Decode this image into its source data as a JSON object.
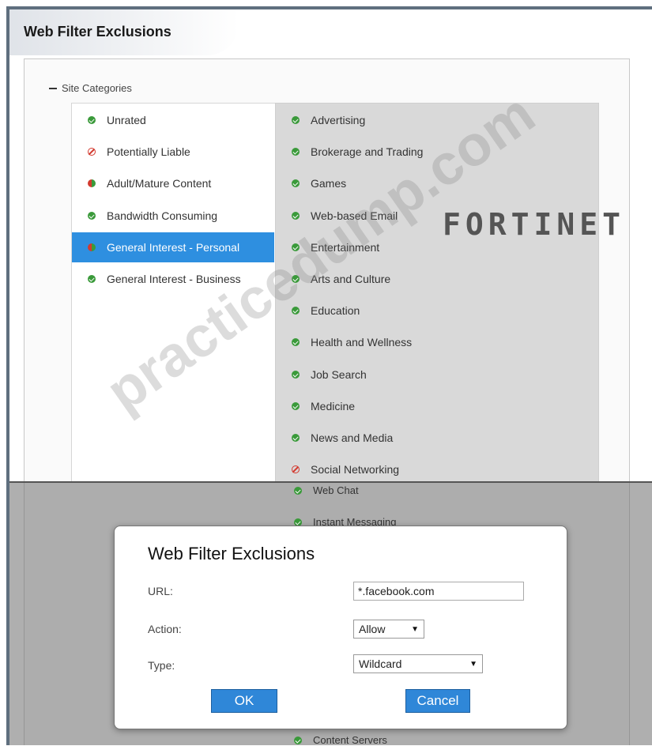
{
  "header": {
    "title": "Web Filter Exclusions"
  },
  "section": {
    "label": "Site Categories"
  },
  "left_categories": [
    {
      "label": "Unrated",
      "status": "allow"
    },
    {
      "label": "Potentially Liable",
      "status": "block"
    },
    {
      "label": "Adult/Mature Content",
      "status": "mixed"
    },
    {
      "label": "Bandwidth Consuming",
      "status": "allow"
    },
    {
      "label": "General Interest - Personal",
      "status": "mixed",
      "selected": true
    },
    {
      "label": "General Interest - Business",
      "status": "allow"
    }
  ],
  "right_categories": [
    {
      "label": "Advertising",
      "status": "allow"
    },
    {
      "label": "Brokerage and Trading",
      "status": "allow"
    },
    {
      "label": "Games",
      "status": "allow"
    },
    {
      "label": "Web-based Email",
      "status": "allow"
    },
    {
      "label": "Entertainment",
      "status": "allow"
    },
    {
      "label": "Arts and Culture",
      "status": "allow"
    },
    {
      "label": "Education",
      "status": "allow"
    },
    {
      "label": "Health and Wellness",
      "status": "allow"
    },
    {
      "label": "Job Search",
      "status": "allow"
    },
    {
      "label": "Medicine",
      "status": "allow"
    },
    {
      "label": "News and Media",
      "status": "allow"
    },
    {
      "label": "Social Networking",
      "status": "block"
    }
  ],
  "background_items": {
    "web_chat": "Web Chat",
    "instant_messaging": "Instant Messaging",
    "content_servers": "Content Servers"
  },
  "dialog": {
    "title": "Web Filter Exclusions",
    "url_label": "URL:",
    "url_value": "*.facebook.com",
    "action_label": "Action:",
    "action_value": "Allow",
    "type_label": "Type:",
    "type_value": "Wildcard",
    "ok_label": "OK",
    "cancel_label": "Cancel"
  },
  "branding": {
    "logo_text": "FORTINET",
    "watermark": "practicedump.com"
  },
  "colors": {
    "selected": "#2e8fe0",
    "allow": "#3a9a3a",
    "block": "#d33a2f",
    "button": "#2f87d8"
  }
}
